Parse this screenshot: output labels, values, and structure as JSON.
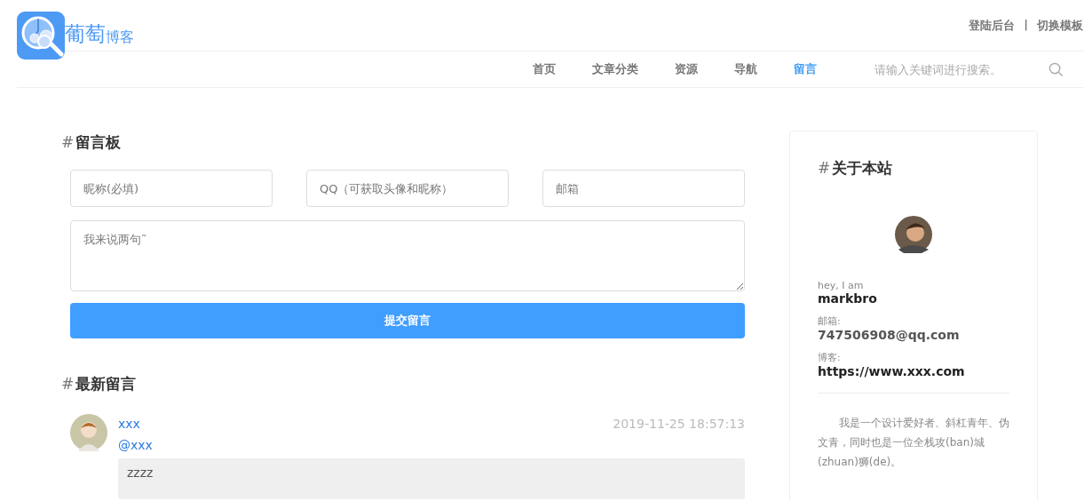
{
  "logo": {
    "title": "葡萄",
    "subtitle": "博客"
  },
  "top_links": [
    {
      "label": "登陆后台"
    },
    {
      "label": "切换模板"
    }
  ],
  "top_links_separator": "|",
  "nav": [
    {
      "label": "首页",
      "selected": false
    },
    {
      "label": "文章分类",
      "selected": false
    },
    {
      "label": "资源",
      "selected": false
    },
    {
      "label": "导航",
      "selected": false
    },
    {
      "label": "留言",
      "selected": true
    }
  ],
  "search": {
    "placeholder": "请输入关键词进行搜索。"
  },
  "guestbook": {
    "hash": "#",
    "title": "留言板",
    "fields": [
      {
        "placeholder": "昵称(必填)"
      },
      {
        "placeholder": "QQ（可获取头像和昵称）"
      },
      {
        "placeholder": "邮箱"
      }
    ],
    "message": {
      "placeholder": "我来说两句˜"
    },
    "submit": "提交留言"
  },
  "latest": {
    "hash": "#",
    "title": "最新留言",
    "comments": [
      {
        "author": "xxx",
        "time": "2019-11-25 18:57:13",
        "reply_to": "@xxx",
        "text": "zzzz"
      }
    ]
  },
  "about": {
    "hash": "#",
    "title": "关于本站",
    "greeting": "hey, I am",
    "name": "markbro",
    "email_label": "邮箱:",
    "email": "747506908@qq.com",
    "blog_label": "博客:",
    "blog": "https://www.xxx.com",
    "bio": "我是一个设计爱好者、斜杠青年、伪文青，同时也是一位全栈攻(ban)城(zhuan)狮(de)。"
  }
}
